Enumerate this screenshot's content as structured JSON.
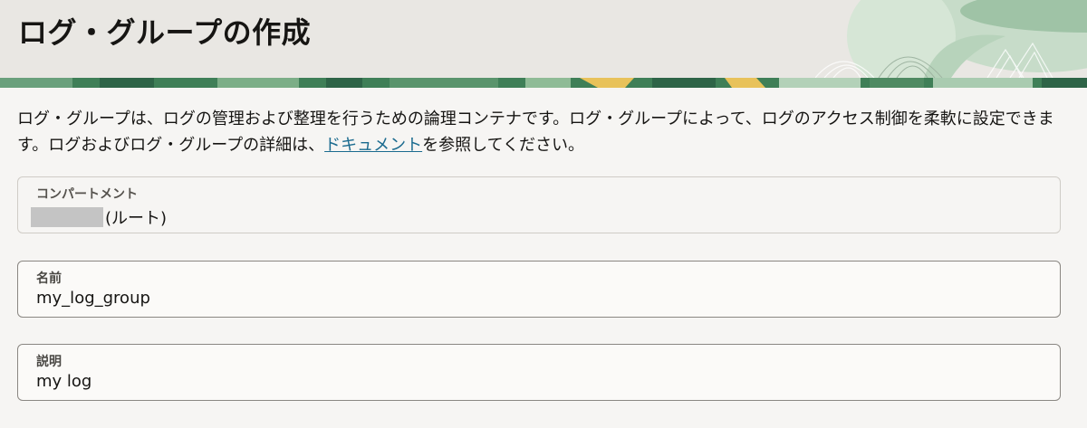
{
  "header": {
    "title": "ログ・グループの作成"
  },
  "intro": {
    "text_before_link": "ログ・グループは、ログの管理および整理を行うための論理コンテナです。ログ・グループによって、ログのアクセス制御を柔軟に設定できます。ログおよびログ・グループの詳細は、",
    "link_text": "ドキュメント",
    "text_after_link": "を参照してください。"
  },
  "compartment": {
    "label": "コンパートメント",
    "value_suffix": "(ルート)"
  },
  "name": {
    "label": "名前",
    "value": "my_log_group"
  },
  "description": {
    "label": "説明",
    "value": "my log"
  },
  "colors": {
    "header_bg": "#e9e7e3",
    "page_bg": "#f6f5f3",
    "link": "#1b6b8f",
    "banner_green": "#3f7f57",
    "banner_yellow": "#e8c25a"
  }
}
